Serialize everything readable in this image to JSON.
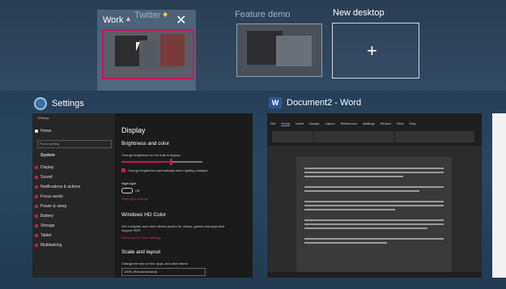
{
  "desktops": {
    "work_label": "Work",
    "twitter_label": "Twitter",
    "feature_label": "Feature demo",
    "new_label": "New desktop",
    "plus_symbol": "+",
    "close_symbol": "✕"
  },
  "windows": {
    "settings": {
      "caption": "Settings",
      "titlebar": "Settings",
      "nav": [
        "Home"
      ],
      "find_placeholder": "Find a setting",
      "section": "System",
      "items": [
        "Display",
        "Sound",
        "Notifications & actions",
        "Focus assist",
        "Power & sleep",
        "Battery",
        "Storage",
        "Tablet",
        "Multitasking"
      ],
      "heading": "Display",
      "brightness_heading": "Brightness and color",
      "brightness_text": "Change brightness for the built-in display",
      "auto_brightness": "Change brightness automatically when lighting changes",
      "night_light": "Night light",
      "night_state": "Off",
      "night_link": "Night light settings",
      "hdr_heading": "Windows HD Color",
      "hdr_text": "Get a brighter and more vibrant picture for videos, games and apps that support HDR.",
      "hdr_link": "Windows HD Color settings",
      "scale_heading": "Scale and layout",
      "scale_text": "Change the size of text, apps, and other items",
      "scale_value": "150% (Recommended)"
    },
    "word": {
      "caption": "Document2 - Word",
      "tabs": [
        "File",
        "Home",
        "Insert",
        "Design",
        "Layout",
        "References",
        "Mailings",
        "Review",
        "View",
        "Help"
      ]
    }
  },
  "colors": {
    "accent": "#c2185b",
    "word_blue": "#2b579a"
  }
}
